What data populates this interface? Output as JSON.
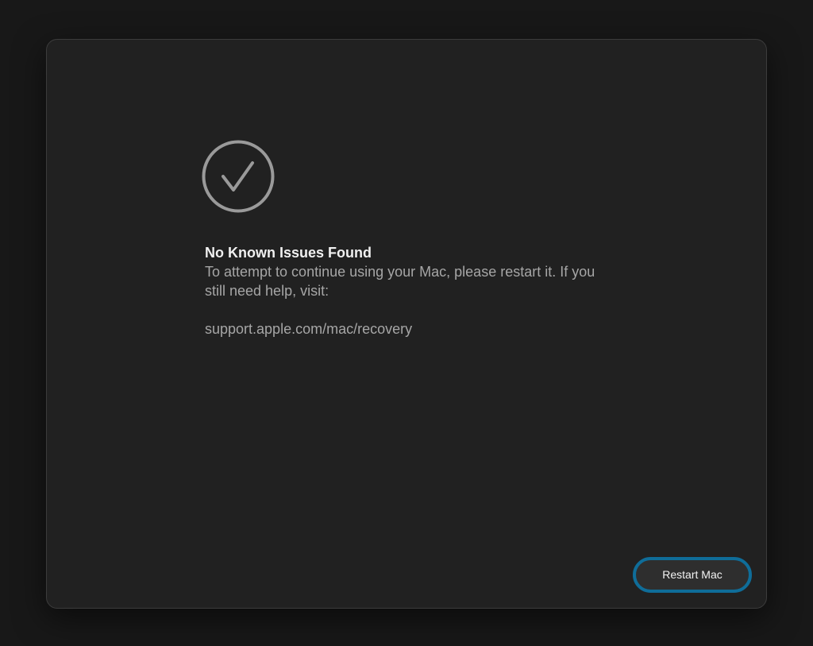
{
  "dialog": {
    "title": "No Known Issues Found",
    "message": "To attempt to continue using your Mac, please restart it. If you still need help, visit:",
    "support_link": "support.apple.com/mac/recovery",
    "icon": "checkmark-circle-icon"
  },
  "actions": {
    "restart_label": "Restart Mac"
  },
  "colors": {
    "background": "#181818",
    "panel": "#212121",
    "title_text": "#f0f0f0",
    "body_text": "#a6a6a6",
    "icon": "#9a9a9a",
    "focus_ring": "#0f6d99"
  }
}
